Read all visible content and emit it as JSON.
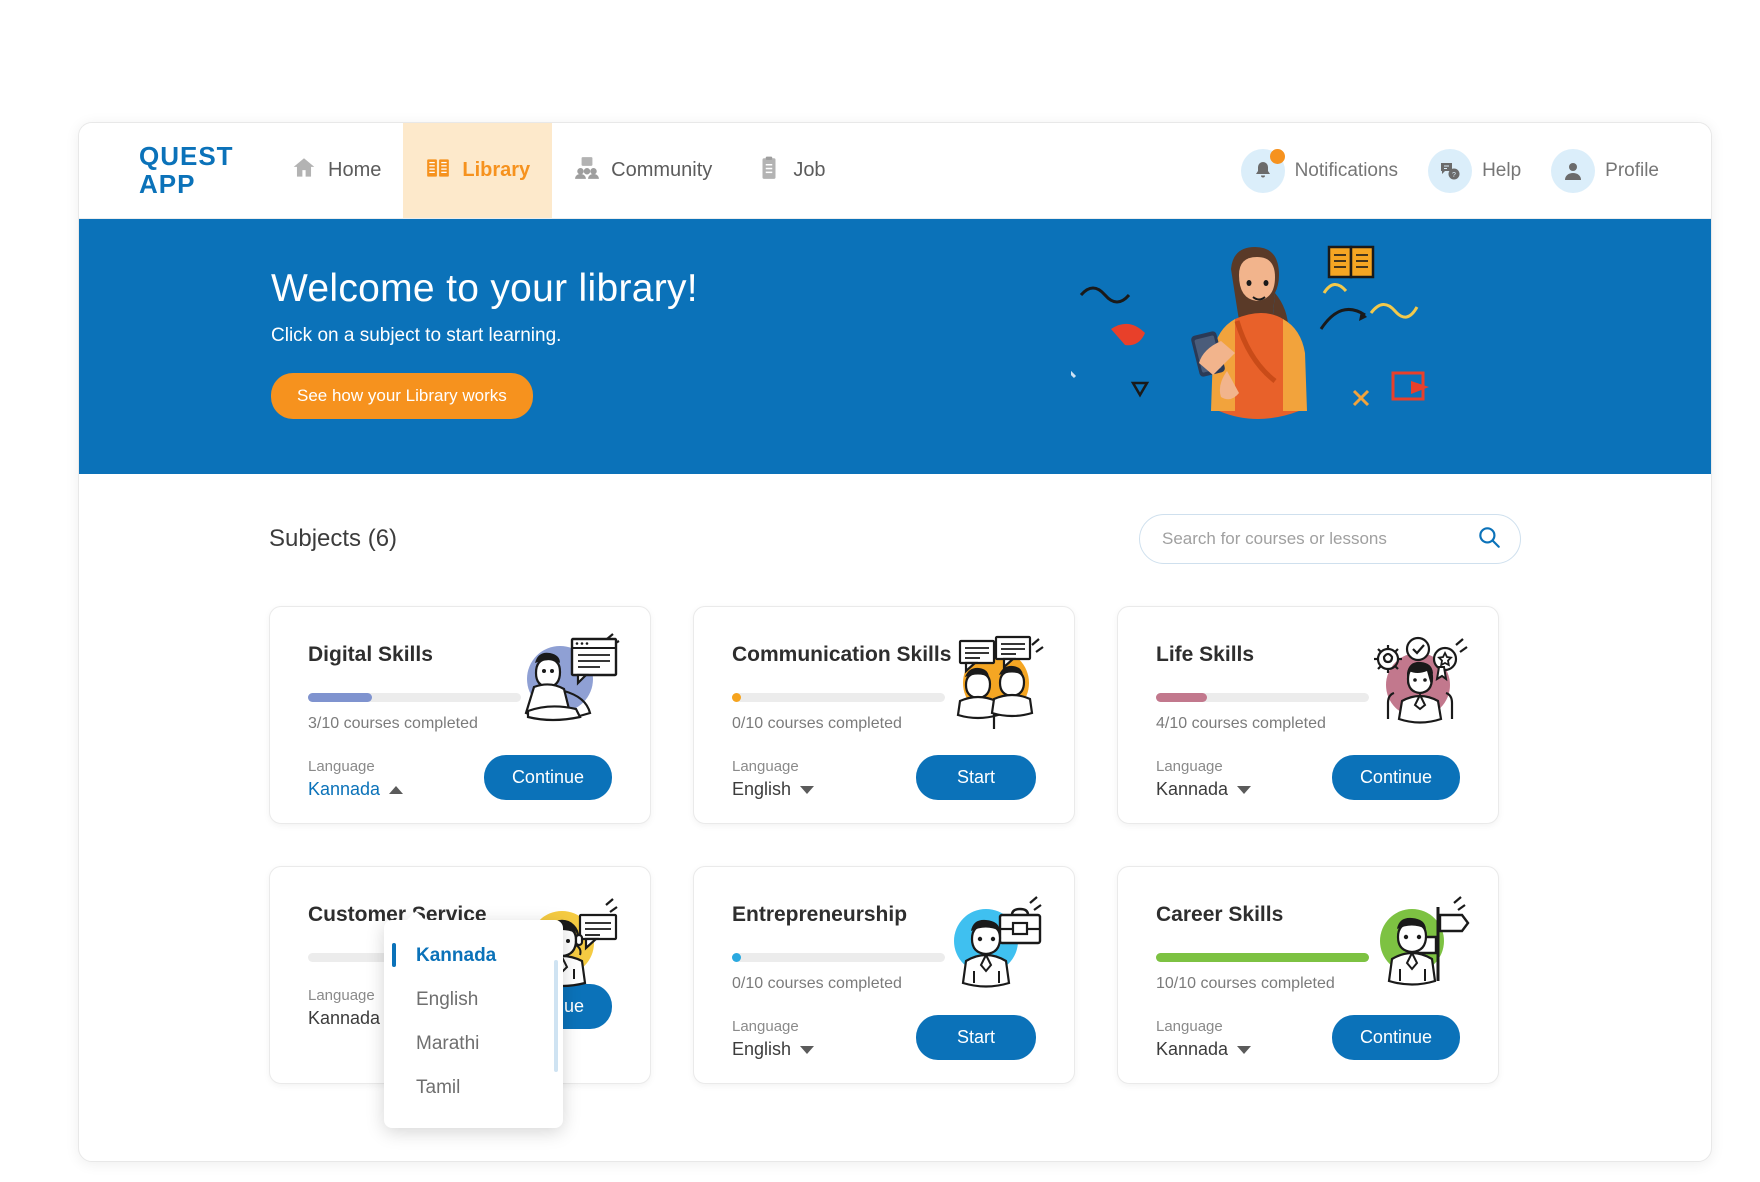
{
  "brand": {
    "line1": "QUEST",
    "line2": "APP"
  },
  "nav": {
    "items": [
      {
        "label": "Home",
        "icon": "home-icon",
        "active": false
      },
      {
        "label": "Library",
        "icon": "book-icon",
        "active": true
      },
      {
        "label": "Community",
        "icon": "people-icon",
        "active": false
      },
      {
        "label": "Job",
        "icon": "briefcase-icon",
        "active": false
      }
    ],
    "right": [
      {
        "label": "Notifications",
        "icon": "bell-icon",
        "badge": true
      },
      {
        "label": "Help",
        "icon": "chat-question-icon",
        "badge": false
      },
      {
        "label": "Profile",
        "icon": "person-icon",
        "badge": false
      }
    ]
  },
  "banner": {
    "title": "Welcome to your library!",
    "subtitle": "Click on a subject to start learning.",
    "button": "See how your Library works",
    "bg_color": "#0b72b9",
    "button_color": "#f6921e"
  },
  "main": {
    "subjects_heading": "Subjects (6)",
    "search": {
      "placeholder": "Search for courses or lessons",
      "value": "",
      "icon": "search-icon"
    },
    "language_label": "Language",
    "cards": [
      {
        "title": "Digital Skills",
        "progress_text": "3/10 courses completed",
        "progress_pct": 30,
        "progress_color": "#7f93cf",
        "art_color": "#8fa0d4",
        "art": "person-laptop-icon",
        "language": "Kannada",
        "cta": "Continue",
        "dropdown_open": true
      },
      {
        "title": "Communication Skills",
        "progress_text": "0/10 courses completed",
        "progress_pct": 3,
        "progress_color": "#f6a41e",
        "art_color": "#f5a623",
        "art": "two-people-speech-icon",
        "language": "English",
        "cta": "Start",
        "dropdown_open": false
      },
      {
        "title": "Life Skills",
        "progress_text": "4/10 courses completed",
        "progress_pct": 24,
        "progress_color": "#c2788d",
        "art_color": "#c2788d",
        "art": "person-badges-icon",
        "language": "Kannada",
        "cta": "Continue",
        "dropdown_open": false
      },
      {
        "title": "Customer Service",
        "progress_text": "",
        "progress_pct": 0,
        "progress_color": "#f0c33c",
        "art_color": "#f5cb42",
        "art": "headset-person-icon",
        "language": "Kannada",
        "cta": "Continue",
        "dropdown_open": false
      },
      {
        "title": "Entrepreneurship",
        "progress_text": "0/10 courses completed",
        "progress_pct": 3,
        "progress_color": "#2aa9e0",
        "art_color": "#3fc0f0",
        "art": "businessman-briefcase-icon",
        "language": "English",
        "cta": "Start",
        "dropdown_open": false
      },
      {
        "title": "Career Skills",
        "progress_text": "10/10 courses completed",
        "progress_pct": 100,
        "progress_color": "#7dc242",
        "art_color": "#7dc242",
        "art": "person-signpost-icon",
        "language": "Kannada",
        "cta": "Continue",
        "dropdown_open": false
      }
    ],
    "language_dropdown": {
      "options": [
        "Kannada",
        "English",
        "Marathi",
        "Tamil"
      ],
      "selected": "Kannada"
    }
  },
  "colors": {
    "brand_blue": "#0b72b9",
    "brand_orange": "#f6921e",
    "nav_active_bg": "#fde9cb"
  }
}
